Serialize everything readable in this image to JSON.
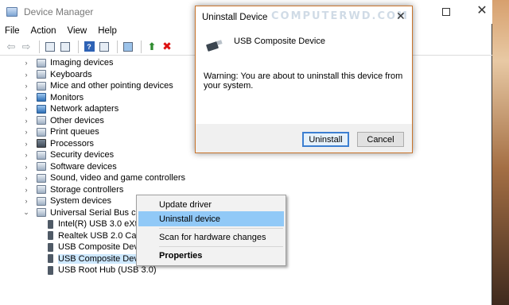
{
  "window": {
    "title": "Device Manager"
  },
  "menu": [
    "File",
    "Action",
    "View",
    "Help"
  ],
  "toolbar": {
    "icons": [
      "back-arrow-icon",
      "forward-arrow-icon",
      "properties-icon",
      "show-hidden-icon",
      "help-icon",
      "update-view-icon",
      "monitor-icon",
      "add-driver-icon",
      "uninstall-x-icon"
    ]
  },
  "tree": {
    "items": [
      {
        "label": "Imaging devices",
        "expander": "›"
      },
      {
        "label": "Keyboards",
        "expander": "›"
      },
      {
        "label": "Mice and other pointing devices",
        "expander": "›"
      },
      {
        "label": "Monitors",
        "expander": "›"
      },
      {
        "label": "Network adapters",
        "expander": "›"
      },
      {
        "label": "Other devices",
        "expander": "›"
      },
      {
        "label": "Print queues",
        "expander": "›"
      },
      {
        "label": "Processors",
        "expander": "›"
      },
      {
        "label": "Security devices",
        "expander": "›"
      },
      {
        "label": "Software devices",
        "expander": "›"
      },
      {
        "label": "Sound, video and game controllers",
        "expander": "›"
      },
      {
        "label": "Storage controllers",
        "expander": "›"
      },
      {
        "label": "System devices",
        "expander": "›"
      },
      {
        "label": "Universal Serial Bus controllers",
        "expander": "⌄"
      }
    ],
    "usb_children": [
      {
        "label": "Intel(R) USB 3.0 eXtensible Host Controller"
      },
      {
        "label": "Realtek USB 2.0 Card Reader"
      },
      {
        "label": "USB Composite Device"
      },
      {
        "label": "USB Composite Device",
        "selected": true
      },
      {
        "label": "USB Root Hub (USB 3.0)"
      }
    ]
  },
  "context_menu": {
    "items": [
      "Update driver",
      "Uninstall device",
      "Scan for hardware changes",
      "Properties"
    ],
    "highlighted": "Uninstall device"
  },
  "dialog": {
    "title": "Uninstall Device",
    "watermark": "COMPUTERWD.COM",
    "device_name": "USB Composite Device",
    "warning": "Warning: You are about to uninstall this device from your system.",
    "uninstall_label": "Uninstall",
    "cancel_label": "Cancel"
  }
}
